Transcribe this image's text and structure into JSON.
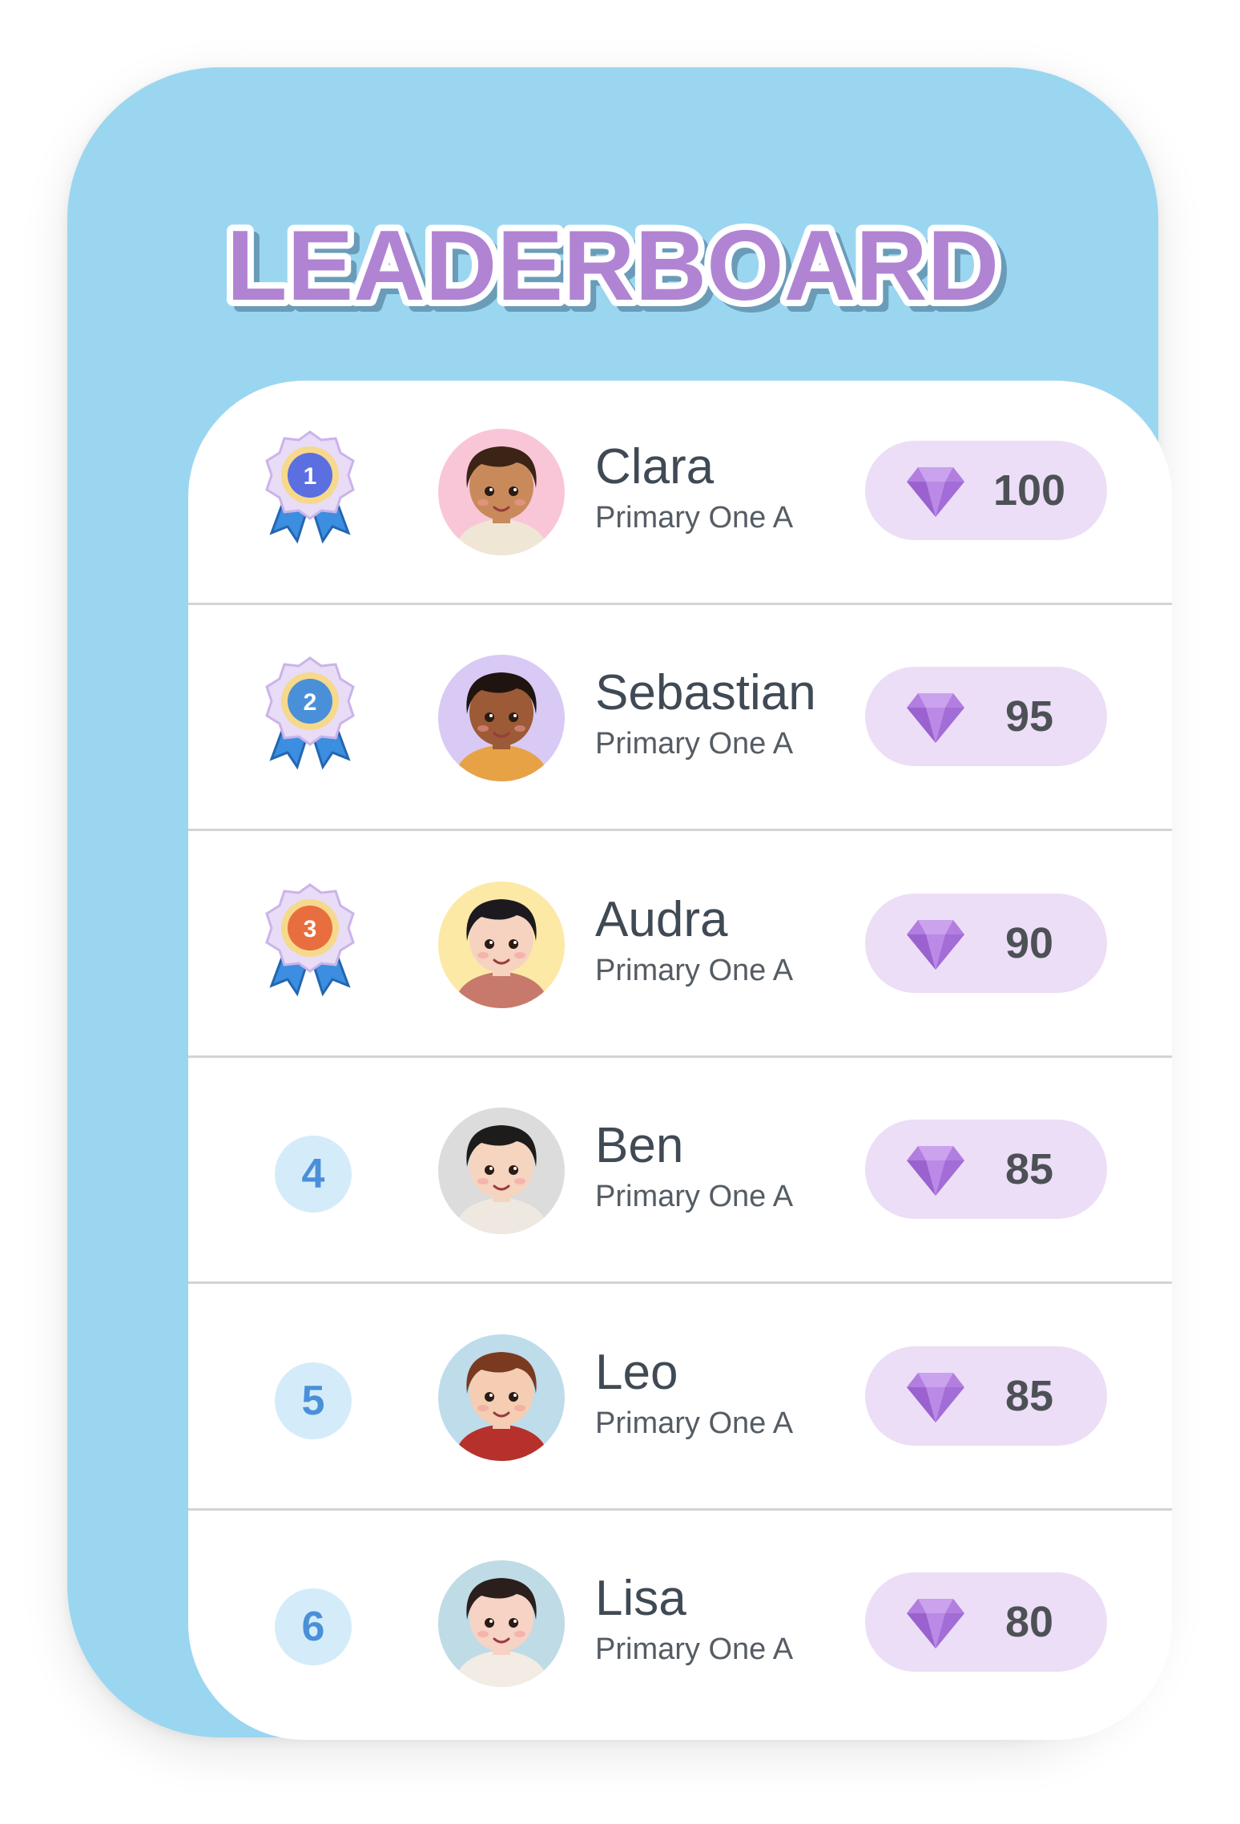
{
  "title": "LEADERBOARD",
  "colors": {
    "frame": "#9bd6f1",
    "title_fill": "#b184d3",
    "title_shadow": "#6a9cb8",
    "pill": "#ecdef6",
    "gem": "#b27ee0",
    "rank_circle": "#d4ecfa",
    "rank_text": "#4a90d9"
  },
  "entries": [
    {
      "rank": "1",
      "badge": "medal-ribbon-icon",
      "medal_color": "#5b6fe0",
      "name": "Clara",
      "class": "Primary One A",
      "score": "100",
      "avatar_bg": "#f9c6d7",
      "avatar_hair": "#3b2416",
      "avatar_skin": "#c98a5b",
      "avatar_shirt": "#f0e6d6"
    },
    {
      "rank": "2",
      "badge": "medal-ribbon-icon",
      "medal_color": "#4a90d9",
      "name": "Sebastian",
      "class": "Primary One A",
      "score": "95",
      "avatar_bg": "#d9c9f5",
      "avatar_hair": "#1f1410",
      "avatar_skin": "#9c5a36",
      "avatar_shirt": "#e7a246"
    },
    {
      "rank": "3",
      "badge": "medal-ribbon-icon",
      "medal_color": "#e86e3f",
      "name": "Audra",
      "class": "Primary One A",
      "score": "90",
      "avatar_bg": "#fde9a6",
      "avatar_hair": "#1c1a1f",
      "avatar_skin": "#f6d2c0",
      "avatar_shirt": "#c77a6c"
    },
    {
      "rank": "4",
      "badge": "rank-number",
      "name": "Ben",
      "class": "Primary One A",
      "score": "85",
      "avatar_bg": "#dcdcdc",
      "avatar_hair": "#1e1b1b",
      "avatar_skin": "#f5d4c0",
      "avatar_shirt": "#efe8e0"
    },
    {
      "rank": "5",
      "badge": "rank-number",
      "name": "Leo",
      "class": "Primary One A",
      "score": "85",
      "avatar_bg": "#bfdceb",
      "avatar_hair": "#7a3a1f",
      "avatar_skin": "#f4cdb3",
      "avatar_shirt": "#b6312b"
    },
    {
      "rank": "6",
      "badge": "rank-number",
      "name": "Lisa",
      "class": "Primary One A",
      "score": "80",
      "avatar_bg": "#bfdbe6",
      "avatar_hair": "#2a1f1c",
      "avatar_skin": "#f6d3c4",
      "avatar_shirt": "#f2ece4"
    }
  ]
}
